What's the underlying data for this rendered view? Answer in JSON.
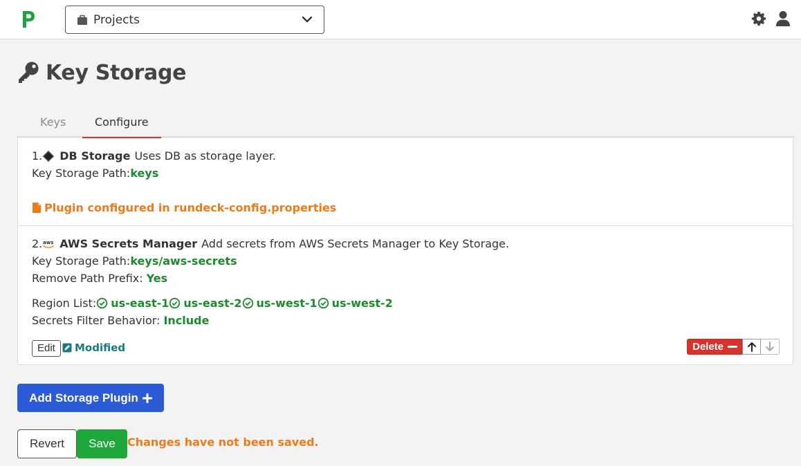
{
  "header": {
    "project_selector_label": "Projects"
  },
  "page": {
    "title": "Key Storage"
  },
  "tabs": [
    {
      "label": "Keys",
      "active": false
    },
    {
      "label": "Configure",
      "active": true
    }
  ],
  "plugins": [
    {
      "index": "1.",
      "name": "DB Storage",
      "description": "Uses DB as storage layer.",
      "path_label": "Key Storage Path:",
      "path_value": "keys",
      "config_note": "Plugin configured in rundeck-config.properties"
    },
    {
      "index": "2.",
      "name": "AWS Secrets Manager",
      "description": "Add secrets from AWS Secrets Manager to Key Storage.",
      "icon_text": "aws",
      "path_label": "Key Storage Path:",
      "path_value": "keys/aws-secrets",
      "prefix_label": "Remove Path Prefix:",
      "prefix_value": "Yes",
      "region_label": "Region List:",
      "regions": [
        "us-east-1",
        "us-east-2",
        "us-west-1",
        "us-west-2"
      ],
      "filter_label": "Secrets Filter Behavior:",
      "filter_value": "Include",
      "edit_label": "Edit",
      "modified_label": "Modified",
      "delete_label": "Delete"
    }
  ],
  "footer": {
    "add_label": "Add Storage Plugin",
    "revert_label": "Revert",
    "save_label": "Save",
    "unsaved_message": "Changes have not been saved."
  },
  "colors": {
    "accent_blue": "#2b5bd6",
    "success_green": "#1ea83a",
    "value_green": "#1d8a2e",
    "warning_orange": "#f07a1a",
    "danger_red": "#d9312c"
  },
  "icons": {
    "logo": "pagerduty-p-logo",
    "project": "briefcase-icon",
    "settings": "gear-icon",
    "user": "user-icon",
    "title": "key-icon",
    "plugin1": "diamond-icon",
    "plugin2": "aws-logo-icon",
    "file": "file-icon",
    "check": "check-circle-icon",
    "modified": "pencil-square-icon"
  }
}
